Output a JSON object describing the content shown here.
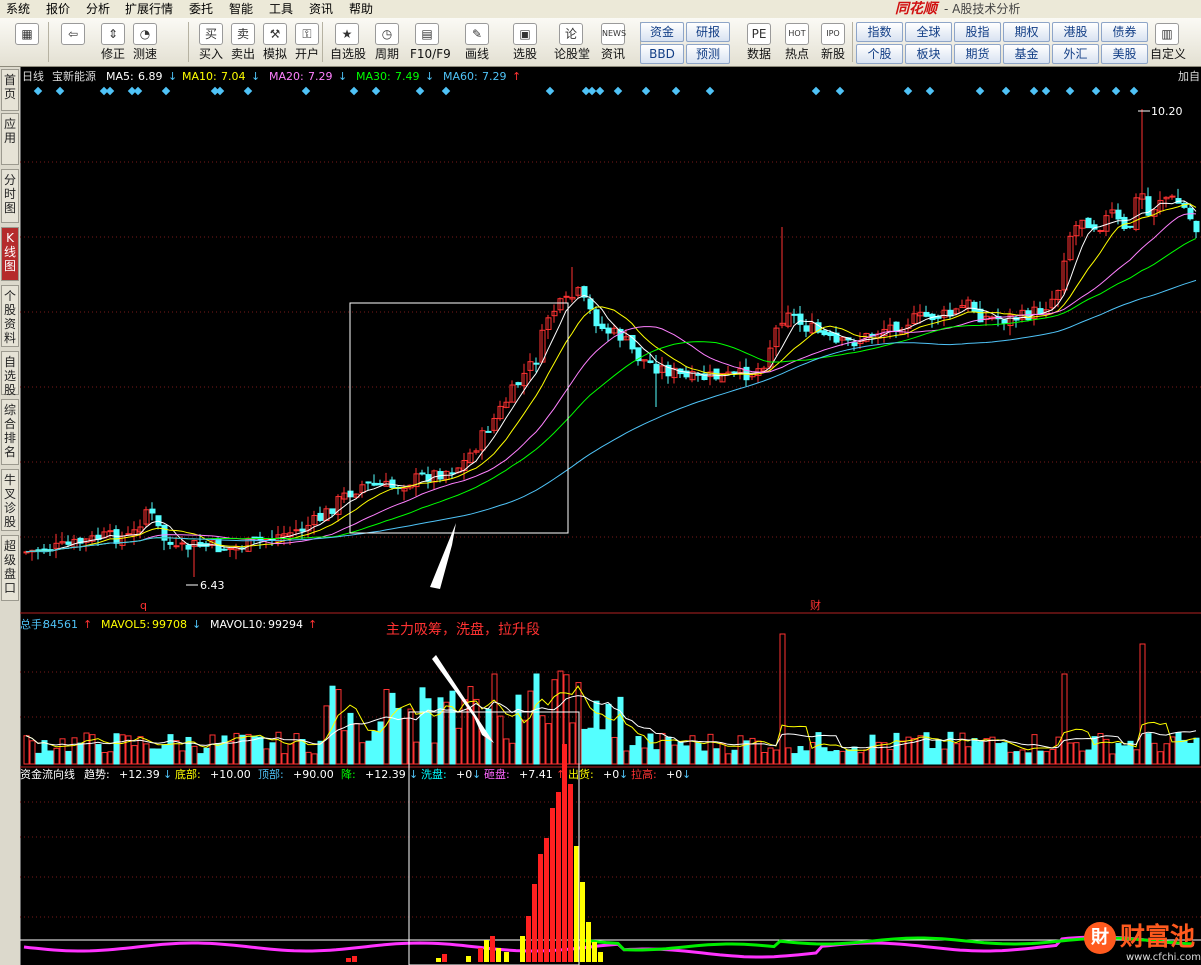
{
  "menu": [
    "系统",
    "报价",
    "分析",
    "扩展行情",
    "委托",
    "智能",
    "工具",
    "资讯",
    "帮助"
  ],
  "brand": {
    "name": "同花顺",
    "subtitle": "- A股技术分析"
  },
  "toolbar": {
    "tools": [
      {
        "label": "",
        "icon": "blocks-icon",
        "glyph": "▦"
      },
      {
        "label": "",
        "icon": "back-arrow-icon",
        "glyph": "⇦"
      },
      {
        "label": "修正",
        "icon": "fix-icon",
        "glyph": "⇕"
      },
      {
        "label": "测速",
        "icon": "speed-test-icon",
        "glyph": "◔"
      },
      {
        "label": "买入",
        "icon": "buy-icon",
        "glyph": "买"
      },
      {
        "label": "卖出",
        "icon": "sell-icon",
        "glyph": "卖"
      },
      {
        "label": "模拟",
        "icon": "simulate-icon",
        "glyph": "⚒"
      },
      {
        "label": "开户",
        "icon": "lock-icon",
        "glyph": "⚿"
      },
      {
        "label": "自选股",
        "icon": "star-icon",
        "glyph": "★"
      },
      {
        "label": "周期",
        "icon": "clock-icon",
        "glyph": "◷"
      },
      {
        "label": "F10/F9",
        "icon": "f10-icon",
        "glyph": "▤"
      },
      {
        "label": "画线",
        "icon": "pencil-icon",
        "glyph": "✎"
      },
      {
        "label": "选股",
        "icon": "screener-icon",
        "glyph": "▣"
      },
      {
        "label": "论股堂",
        "icon": "forum-icon",
        "glyph": "论"
      },
      {
        "label": "资讯",
        "icon": "news-icon",
        "glyph": "NEWS"
      },
      {
        "label": "数据",
        "icon": "pe-icon",
        "glyph": "PE"
      },
      {
        "label": "热点",
        "icon": "hot-icon",
        "glyph": "HOT"
      },
      {
        "label": "新股",
        "icon": "ipo-icon",
        "glyph": "IPO"
      },
      {
        "label": "自定义",
        "icon": "custom-icon",
        "glyph": "▥"
      }
    ],
    "quick_a": [
      "资金",
      "研报",
      "BBD",
      "预测"
    ],
    "quick_b": [
      "指数",
      "全球",
      "股指",
      "期权",
      "港股",
      "债券",
      "个股",
      "板块",
      "期货",
      "基金",
      "外汇",
      "美股"
    ]
  },
  "sidebar": [
    "首页",
    "应用",
    "分时图",
    "K线图",
    "个股资料",
    "自选股",
    "综合排名",
    "牛叉诊股",
    "超级盘口"
  ],
  "kline": {
    "period": "日线",
    "stock": "宝新能源",
    "ma": [
      {
        "label": "MA5:",
        "value": "6.89",
        "trend": "↓",
        "color": "#ffffff"
      },
      {
        "label": "MA10:",
        "value": "7.04",
        "trend": "↓",
        "color": "#ffff00"
      },
      {
        "label": "MA20:",
        "value": "7.29",
        "trend": "↓",
        "color": "#ff80ff"
      },
      {
        "label": "MA30:",
        "value": "7.49",
        "trend": "↓",
        "color": "#00ff00"
      },
      {
        "label": "MA60:",
        "value": "7.29",
        "trend": "↑",
        "color": "#4fc3f7"
      }
    ],
    "high_label": "10.20",
    "low_label": "6.43",
    "right_tab": "加自",
    "marker_q": "q",
    "marker_cai": "财",
    "annotation": "主力吸筹，洗盘，拉升段"
  },
  "volume": {
    "items": [
      {
        "label": "总手:",
        "value": "84561",
        "trend": "↑",
        "color": "#4fc3f7",
        "vcolor": "#4fc3f7"
      },
      {
        "label": "MAVOL5:",
        "value": "99708",
        "trend": "↓",
        "color": "#ffff00",
        "vcolor": "#ffff00"
      },
      {
        "label": "MAVOL10:",
        "value": "99294",
        "trend": "↑",
        "color": "#ffffff",
        "vcolor": "#ffffff"
      }
    ]
  },
  "flow": {
    "title": "资金流向线",
    "items": [
      {
        "label": "趋势:",
        "value": "+12.39",
        "trend": "↓",
        "color": "#ffffff"
      },
      {
        "label": "底部:",
        "value": "+10.00",
        "trend": "",
        "color": "#ffff00"
      },
      {
        "label": "顶部:",
        "value": "+90.00",
        "trend": "",
        "color": "#4fc3f7"
      },
      {
        "label": "降:",
        "value": "+12.39",
        "trend": "↓",
        "color": "#00ff00"
      },
      {
        "label": "洗盘:",
        "value": "+0",
        "trend": "↓",
        "color": "#00ffff"
      },
      {
        "label": "砸盘:",
        "value": "+7.41",
        "trend": "↑",
        "color": "#ff66ff"
      },
      {
        "label": "出货:",
        "value": "+0",
        "trend": "↓",
        "color": "#ffff00"
      },
      {
        "label": "拉高:",
        "value": "+0",
        "trend": "↓",
        "color": "#ff3333"
      }
    ]
  },
  "watermark": {
    "text": "财富池",
    "url": "www.cfchi.com"
  },
  "colors": {
    "up": "#ff3232",
    "down": "#54ffff",
    "ma5": "#ffffff",
    "ma10": "#ffff00",
    "ma20": "#ff80ff",
    "ma30": "#00ff00",
    "ma60": "#4fc3f7"
  }
}
